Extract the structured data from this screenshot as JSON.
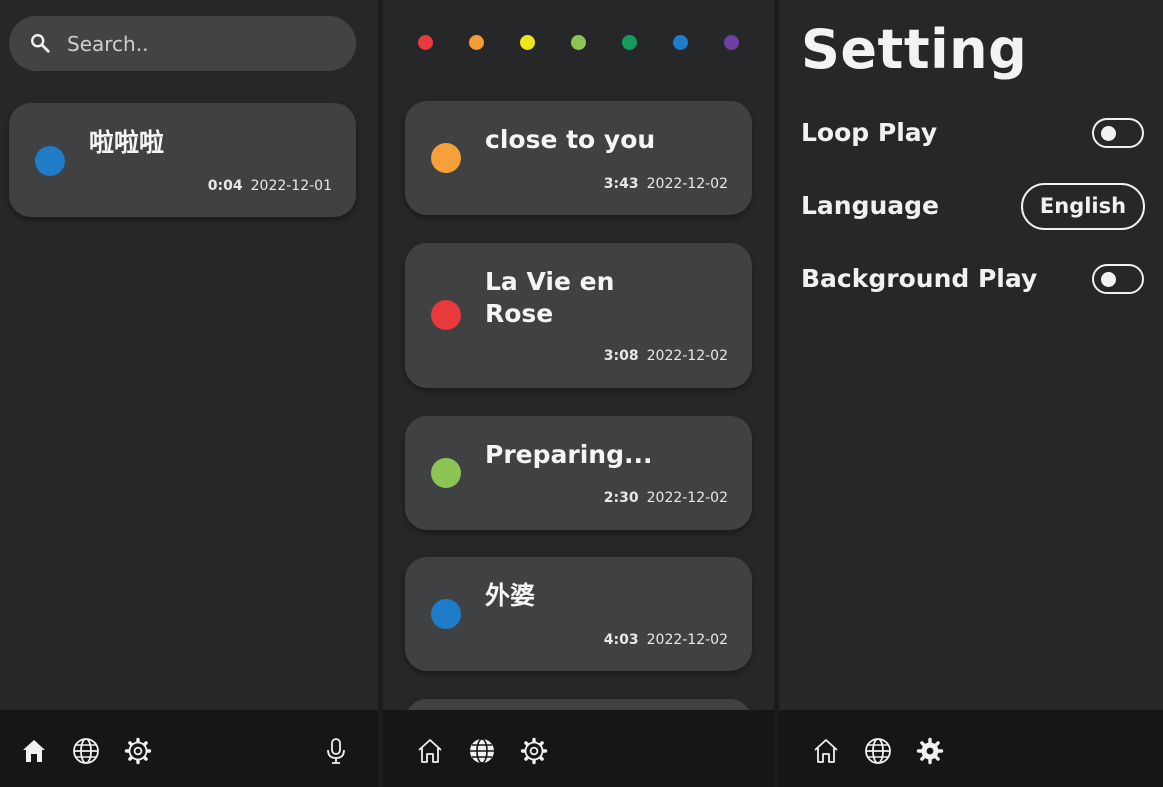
{
  "panels": {
    "home": {
      "search": {
        "placeholder": "Search.."
      },
      "recordings": [
        {
          "title": "啦啦啦",
          "duration": "0:04",
          "date": "2022-12-01",
          "color": "#1f7cc8"
        }
      ]
    },
    "list": {
      "filter_colors": [
        "#e8393b",
        "#f39c36",
        "#f0e41a",
        "#8cc554",
        "#169c5a",
        "#1f7cc8",
        "#6f3fa0"
      ],
      "recordings": [
        {
          "title": "close to you",
          "duration": "3:43",
          "date": "2022-12-02",
          "color": "#f6a03a"
        },
        {
          "title_lines": [
            "La Vie en",
            "Rose"
          ],
          "duration": "3:08",
          "date": "2022-12-02",
          "color": "#e8393b"
        },
        {
          "title": "Preparing...",
          "duration": "2:30",
          "date": "2022-12-02",
          "color": "#8cc554"
        },
        {
          "title": "外婆",
          "duration": "4:03",
          "date": "2022-12-02",
          "color": "#1f7cc8"
        }
      ]
    },
    "settings": {
      "title": "Setting",
      "loop_play": {
        "label": "Loop Play",
        "enabled": false
      },
      "language": {
        "label": "Language",
        "value": "English"
      },
      "background_play": {
        "label": "Background Play",
        "enabled": false
      }
    }
  },
  "nav": {
    "icons": [
      "home-icon",
      "globe-icon",
      "gear-icon",
      "microphone-icon"
    ]
  }
}
